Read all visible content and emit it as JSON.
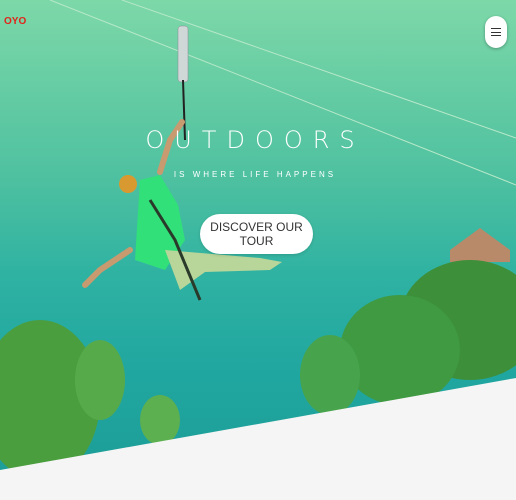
{
  "header": {
    "logo_text": "OYO",
    "menu_icon": "hamburger-icon"
  },
  "hero": {
    "title": "OUTDOORS",
    "subtitle": "IS WHERE LIFE HAPPENS",
    "cta_label": "DISCOVER OUR TOUR"
  },
  "colors": {
    "brand": "#e2231a",
    "overlay": "#4fc1a0",
    "button": "#ffffff"
  }
}
